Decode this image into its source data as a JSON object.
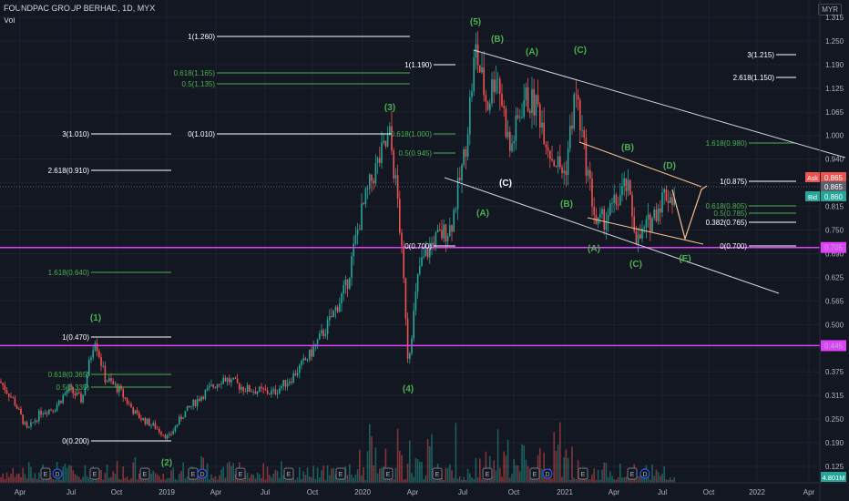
{
  "header": {
    "title": "FOUNDPAC GROUP BERHAD, 1D, MYX",
    "vol_label": "Vol",
    "currency": "MYR"
  },
  "chart_data": {
    "type": "candlestick",
    "x_ticks": [
      "Apr",
      "Jul",
      "Oct",
      "2019",
      "Apr",
      "Jul",
      "Oct",
      "2020",
      "Apr",
      "Jul",
      "Oct",
      "2021",
      "Apr",
      "Jul",
      "Oct",
      "2022",
      "Apr"
    ],
    "y_ticks": [
      "1.315",
      "1.250",
      "1.190",
      "1.125",
      "1.065",
      "1.000",
      "0.940",
      "0.875",
      "0.815",
      "0.750",
      "0.690",
      "0.625",
      "0.565",
      "0.500",
      "0.440",
      "0.375",
      "0.315",
      "0.250",
      "0.190",
      "0.125"
    ],
    "horizontal_lines": [
      {
        "price": 0.705,
        "label": "0.705",
        "color": "#e040fb"
      },
      {
        "price": 0.445,
        "label": "0.445",
        "color": "#e040fb"
      }
    ],
    "price_badges": [
      {
        "label": "Ask",
        "value": "0.865",
        "color": "#ef5350"
      },
      {
        "label": "",
        "value": "0.865",
        "color": "#5d606b"
      },
      {
        "label": "Bid",
        "value": "0.860",
        "color": "#26a69a"
      }
    ],
    "volume_badge": "4.801M",
    "fib_levels": [
      {
        "text": "1(1.260)",
        "color": "#ffffff"
      },
      {
        "text": "0.618(1.165)",
        "color": "#4caf50"
      },
      {
        "text": "0.5(1.135)",
        "color": "#4caf50"
      },
      {
        "text": "1(1.190)",
        "color": "#ffffff"
      },
      {
        "text": "0(1.010)",
        "color": "#ffffff"
      },
      {
        "text": "0.618(1.000)",
        "color": "#4caf50"
      },
      {
        "text": "0.5(0.945)",
        "color": "#4caf50"
      },
      {
        "text": "0(0.700)",
        "color": "#ffffff"
      },
      {
        "text": "3(1.010)",
        "color": "#ffffff"
      },
      {
        "text": "2.618(0.910)",
        "color": "#ffffff"
      },
      {
        "text": "1.618(0.640)",
        "color": "#4caf50"
      },
      {
        "text": "1(0.470)",
        "color": "#ffffff"
      },
      {
        "text": "0.618(0.365)",
        "color": "#4caf50"
      },
      {
        "text": "0.5(0.335)",
        "color": "#4caf50"
      },
      {
        "text": "0(0.200)",
        "color": "#ffffff"
      },
      {
        "text": "3(1.215)",
        "color": "#ffffff"
      },
      {
        "text": "2.618(1.150)",
        "color": "#ffffff"
      },
      {
        "text": "1.618(0.980)",
        "color": "#4caf50"
      },
      {
        "text": "1(0.875)",
        "color": "#ffffff"
      },
      {
        "text": "0.618(0.805)",
        "color": "#4caf50"
      },
      {
        "text": "0.5(0.785)",
        "color": "#4caf50"
      },
      {
        "text": "0.382(0.765)",
        "color": "#ffffff"
      },
      {
        "text": "0(0.700)",
        "color": "#ffffff"
      }
    ],
    "wave_labels": [
      {
        "text": "(1)",
        "color": "#4caf50"
      },
      {
        "text": "(2)",
        "color": "#4caf50"
      },
      {
        "text": "(3)",
        "color": "#4caf50"
      },
      {
        "text": "(4)",
        "color": "#4caf50"
      },
      {
        "text": "(5)",
        "color": "#4caf50"
      },
      {
        "text": "(B)",
        "color": "#4caf50"
      },
      {
        "text": "(A)",
        "color": "#4caf50"
      },
      {
        "text": "(C)",
        "color": "#4caf50"
      },
      {
        "text": "(A)",
        "color": "#4caf50"
      },
      {
        "text": "(C)",
        "color": "#ffffff"
      },
      {
        "text": "(B)",
        "color": "#4caf50"
      },
      {
        "text": "(B)",
        "color": "#4caf50"
      },
      {
        "text": "(D)",
        "color": "#4caf50"
      },
      {
        "text": "(A)",
        "color": "#4caf50"
      },
      {
        "text": "(C)",
        "color": "#4caf50"
      },
      {
        "text": "(E)",
        "color": "#4caf50"
      }
    ],
    "event_markers": [
      "E",
      "D",
      "E",
      "E",
      "E",
      "D",
      "E",
      "E",
      "E",
      "E",
      "E",
      "E",
      "E",
      "D",
      "E",
      "E",
      "D",
      "E",
      "D"
    ],
    "colors": {
      "up": "#26a69a",
      "down": "#ef5350",
      "background": "#131722",
      "grid": "#1e222d",
      "trend": "#d1d4dc",
      "triangle": "#f6c18f"
    }
  }
}
